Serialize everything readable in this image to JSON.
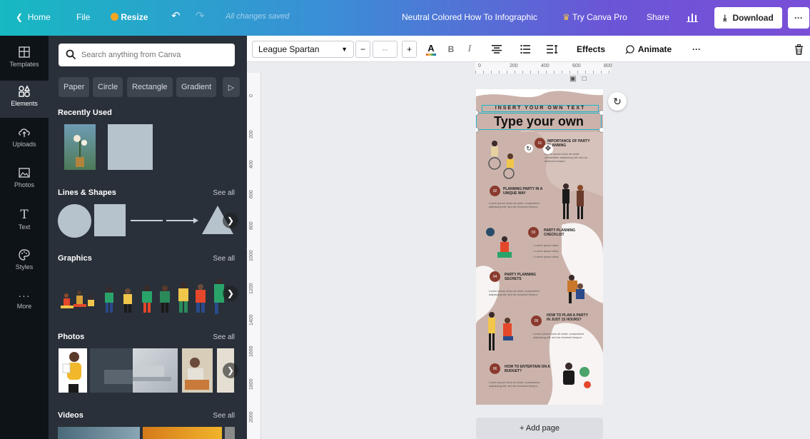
{
  "topbar": {
    "home": "Home",
    "file": "File",
    "resize": "Resize",
    "saved": "All changes saved",
    "title": "Neutral Colored How To Infographic",
    "try_pro": "Try Canva Pro",
    "share": "Share",
    "download": "Download",
    "more": "···"
  },
  "rail": {
    "items": [
      "Templates",
      "Elements",
      "Uploads",
      "Photos",
      "Text",
      "Styles",
      "More"
    ]
  },
  "panel": {
    "search_placeholder": "Search anything from Canva",
    "chips": [
      "Paper",
      "Circle",
      "Rectangle",
      "Gradient"
    ],
    "recent": "Recently Used",
    "lines": "Lines & Shapes",
    "graphics": "Graphics",
    "photos": "Photos",
    "videos": "Videos",
    "see_all": "See all"
  },
  "toolbar": {
    "font": "League Spartan",
    "minus": "−",
    "size": "--",
    "plus": "+",
    "effects": "Effects",
    "animate": "Animate",
    "more": "···"
  },
  "ruler": {
    "h": [
      "0",
      "200",
      "400",
      "600",
      "800"
    ],
    "v": [
      "0",
      "200",
      "400",
      "600",
      "800",
      "1000",
      "1200",
      "1400",
      "1600",
      "1800",
      "2000"
    ]
  },
  "design": {
    "tagline": "INSERT YOUR OWN TEXT",
    "heading": "Type your own",
    "sections": [
      {
        "num": "01",
        "title": "IMPORTANCE OF PARTY PLANNING"
      },
      {
        "num": "02",
        "title": "PLANNING PARTY IN A UNIQUE WAY"
      },
      {
        "num": "03",
        "title": "PARTY PLANNING CHECKLIST"
      },
      {
        "num": "04",
        "title": "PARTY PLANNING SECRETS"
      },
      {
        "num": "05",
        "title": "HOW TO PLAN A PARTY IN JUST 15 HOURS?"
      },
      {
        "num": "06",
        "title": "HOW TO ENTERTAIN ON A BUDGET?"
      }
    ],
    "lorem": "Lorem ipsum dolor sit amet, consectetur adipiscing elit, sed do eiusmod tempor.",
    "bullet": "Lorem ipsum dolor."
  },
  "canvas": {
    "add_page": "+ Add page"
  },
  "colors": {
    "accent": "#8a3a2e",
    "blob": "#cbb3ab",
    "selection": "#1fb5c9"
  }
}
